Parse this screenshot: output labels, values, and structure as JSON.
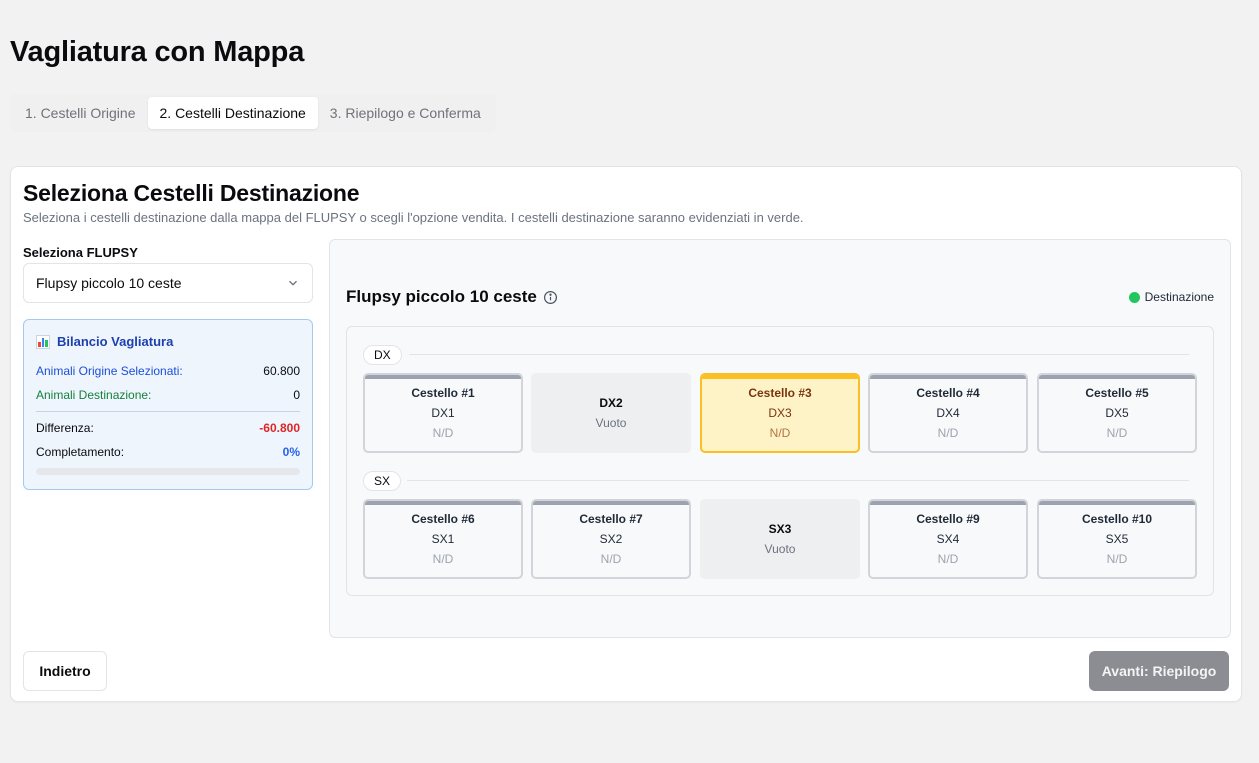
{
  "page": {
    "title": "Vagliatura con Mappa"
  },
  "tabs": [
    {
      "label": "1. Cestelli Origine",
      "active": false
    },
    {
      "label": "2. Cestelli Destinazione",
      "active": true
    },
    {
      "label": "3. Riepilogo e Conferma",
      "active": false
    }
  ],
  "card": {
    "title": "Seleziona Cestelli Destinazione",
    "description": "Seleziona i cestelli destinazione dalla mappa del FLUPSY o scegli l'opzione vendita. I cestelli destinazione saranno evidenziati in verde."
  },
  "flupsy_select": {
    "label": "Seleziona FLUPSY",
    "value": "Flupsy piccolo 10 ceste",
    "icon": "chevron-down-icon"
  },
  "balance": {
    "title": "Bilancio Vagliatura",
    "icon": "bar-chart-icon",
    "origin_label": "Animali Origine Selezionati:",
    "origin_value": "60.800",
    "dest_label": "Animali Destinazione:",
    "dest_value": "0",
    "diff_label": "Differenza:",
    "diff_value": "-60.800",
    "completion_label": "Completamento:",
    "completion_value": "0%",
    "completion_fraction": 0,
    "colors": {
      "origin": "#1d4ed8",
      "dest": "#15803d",
      "negative": "#dc2626",
      "progress": "#2563eb"
    }
  },
  "map": {
    "title": "Flupsy piccolo 10 ceste",
    "info_icon": "info-icon",
    "legend_label": "Destinazione",
    "legend_color": "#22c55e",
    "rows": [
      {
        "label": "DX",
        "slots": [
          {
            "type": "basket",
            "name": "Cestello #1",
            "position": "DX1",
            "value": "N/D"
          },
          {
            "type": "empty",
            "name": "DX2",
            "position": "Vuoto"
          },
          {
            "type": "selected",
            "name": "Cestello #3",
            "position": "DX3",
            "value": "N/D"
          },
          {
            "type": "basket",
            "name": "Cestello #4",
            "position": "DX4",
            "value": "N/D"
          },
          {
            "type": "basket",
            "name": "Cestello #5",
            "position": "DX5",
            "value": "N/D"
          }
        ]
      },
      {
        "label": "SX",
        "slots": [
          {
            "type": "basket",
            "name": "Cestello #6",
            "position": "SX1",
            "value": "N/D"
          },
          {
            "type": "basket",
            "name": "Cestello #7",
            "position": "SX2",
            "value": "N/D"
          },
          {
            "type": "empty",
            "name": "SX3",
            "position": "Vuoto"
          },
          {
            "type": "basket",
            "name": "Cestello #9",
            "position": "SX4",
            "value": "N/D"
          },
          {
            "type": "basket",
            "name": "Cestello #10",
            "position": "SX5",
            "value": "N/D"
          }
        ]
      }
    ]
  },
  "actions": {
    "back_label": "Indietro",
    "next_label": "Avanti: Riepilogo"
  }
}
